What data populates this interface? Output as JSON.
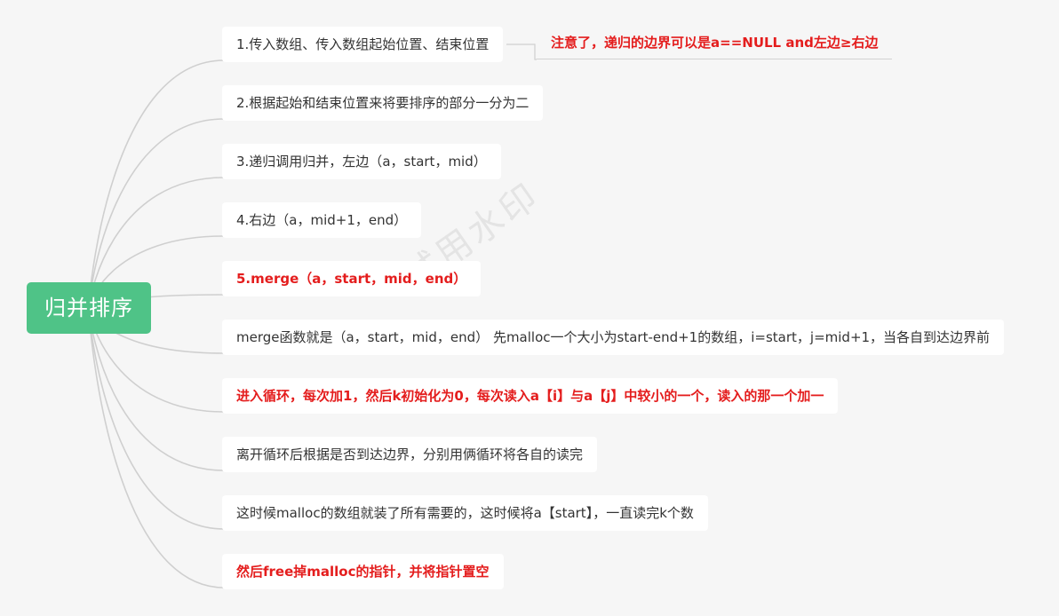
{
  "root": {
    "label": "归并排序"
  },
  "branches": [
    {
      "text": "1.传入数组、传入数组起始位置、结束位置",
      "emphasis": false
    },
    {
      "text": "2.根据起始和结束位置来将要排序的部分一分为二",
      "emphasis": false
    },
    {
      "text": " 3.递归调用归并，左边（a，start，mid）",
      "emphasis": false
    },
    {
      "text": "4.右边（a，mid+1，end）",
      "emphasis": false
    },
    {
      "text": "5.merge（a，start，mid，end）",
      "emphasis": true
    },
    {
      "text": "merge函数就是（a，start，mid，end） 先malloc一个大小为start-end+1的数组，i=start，j=mid+1，当各自到达边界前",
      "emphasis": false
    },
    {
      "text": "进入循环，每次加1，然后k初始化为0，每次读入a【i】与a【j】中较小的一个，读入的那一个加一",
      "emphasis": true
    },
    {
      "text": "离开循环后根据是否到达边界，分别用俩循环将各自的读完",
      "emphasis": false
    },
    {
      "text": "这时候malloc的数组就装了所有需要的，这时候将a【start】，一直读完k个数",
      "emphasis": false
    },
    {
      "text": "然后free掉malloc的指针，并将指针置空",
      "emphasis": true
    }
  ],
  "note": {
    "text": "注意了，递归的边界可以是a==NULL and左边≥右边"
  },
  "watermark": {
    "text": "试用水印"
  },
  "colors": {
    "root_bg": "#4fc387",
    "emphasis_text": "#e41d1d",
    "link_line": "#cfcfcf"
  }
}
